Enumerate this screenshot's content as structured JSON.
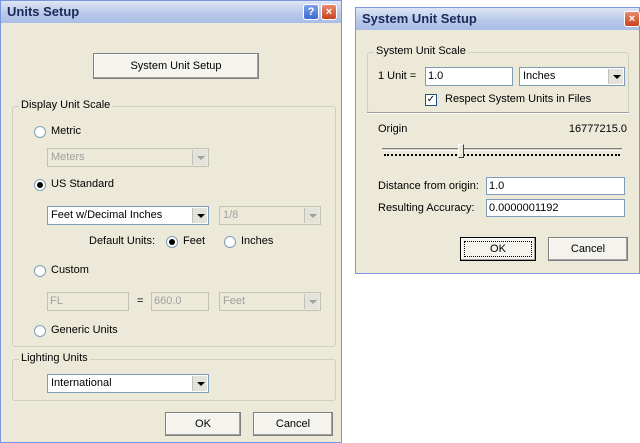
{
  "units_setup": {
    "title": "Units Setup",
    "help_icon": "?",
    "close_icon": "×",
    "system_unit_setup_button": "System Unit Setup",
    "display_unit_scale": {
      "label": "Display Unit Scale",
      "metric": {
        "label": "Metric",
        "selected": false,
        "dropdown": "Meters"
      },
      "us_standard": {
        "label": "US Standard",
        "selected": true,
        "format_dropdown": "Feet w/Decimal Inches",
        "fraction_dropdown": "1/8",
        "default_units_label": "Default Units:",
        "feet_label": "Feet",
        "inches_label": "Inches",
        "default_units_selected": "Feet"
      },
      "custom": {
        "label": "Custom",
        "selected": false,
        "name_value": "FL",
        "equals": "=",
        "amount_value": "660.0",
        "unit_dropdown": "Feet"
      },
      "generic_units": {
        "label": "Generic Units",
        "selected": false
      }
    },
    "lighting_units": {
      "label": "Lighting Units",
      "dropdown": "International"
    },
    "ok_button": "OK",
    "cancel_button": "Cancel"
  },
  "system_unit_setup": {
    "title": "System Unit Setup",
    "close_icon": "×",
    "system_unit_scale": {
      "label": "System Unit Scale",
      "unit_label": "1 Unit =",
      "unit_value": "1.0",
      "unit_dropdown": "Inches",
      "respect_label": "Respect System Units in Files",
      "respect_checked": true,
      "check_mark": "✓"
    },
    "origin_label": "Origin",
    "origin_value": "16777215.0",
    "distance_label": "Distance from origin:",
    "distance_value": "1.0",
    "accuracy_label": "Resulting Accuracy:",
    "accuracy_value": "0.0000001192",
    "ok_button": "OK",
    "cancel_button": "Cancel"
  }
}
